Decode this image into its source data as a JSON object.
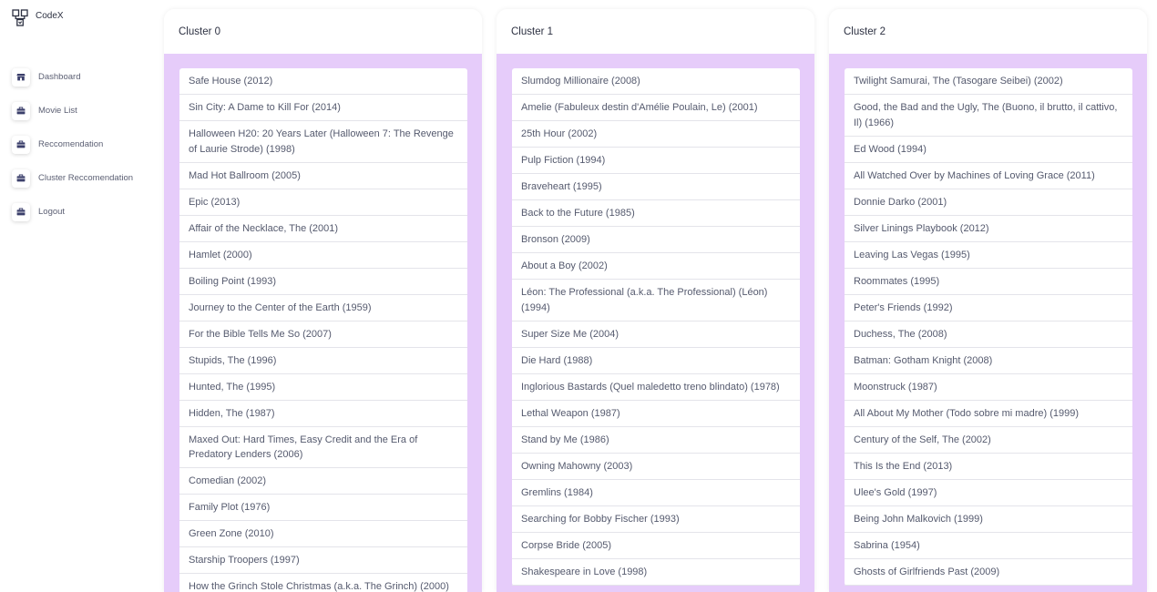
{
  "app": {
    "brand": "CodeX"
  },
  "sidebar": {
    "items": [
      {
        "label": "Dashboard",
        "icon": "store-icon"
      },
      {
        "label": "Movie List",
        "icon": "briefcase-icon"
      },
      {
        "label": "Reccomendation",
        "icon": "briefcase-icon"
      },
      {
        "label": "Cluster Reccomendation",
        "icon": "briefcase-icon"
      },
      {
        "label": "Logout",
        "icon": "briefcase-icon"
      }
    ]
  },
  "clusters": [
    {
      "title": "Cluster 0",
      "movies": [
        "Safe House (2012)",
        "Sin City: A Dame to Kill For (2014)",
        "Halloween H20: 20 Years Later (Halloween 7: The Revenge of Laurie Strode) (1998)",
        "Mad Hot Ballroom (2005)",
        "Epic (2013)",
        "Affair of the Necklace, The (2001)",
        "Hamlet (2000)",
        "Boiling Point (1993)",
        "Journey to the Center of the Earth (1959)",
        "For the Bible Tells Me So (2007)",
        "Stupids, The (1996)",
        "Hunted, The (1995)",
        "Hidden, The (1987)",
        "Maxed Out: Hard Times, Easy Credit and the Era of Predatory Lenders (2006)",
        "Comedian (2002)",
        "Family Plot (1976)",
        "Green Zone (2010)",
        "Starship Troopers (1997)",
        "How the Grinch Stole Christmas (a.k.a. The Grinch) (2000)"
      ]
    },
    {
      "title": "Cluster 1",
      "movies": [
        "Slumdog Millionaire (2008)",
        "Amelie (Fabuleux destin d'Amélie Poulain, Le) (2001)",
        "25th Hour (2002)",
        "Pulp Fiction (1994)",
        "Braveheart (1995)",
        "Back to the Future (1985)",
        "Bronson (2009)",
        "About a Boy (2002)",
        "Léon: The Professional (a.k.a. The Professional) (Léon) (1994)",
        "Super Size Me (2004)",
        "Die Hard (1988)",
        "Inglorious Bastards (Quel maledetto treno blindato) (1978)",
        "Lethal Weapon (1987)",
        "Stand by Me (1986)",
        "Owning Mahowny (2003)",
        "Gremlins (1984)",
        "Searching for Bobby Fischer (1993)",
        "Corpse Bride (2005)",
        "Shakespeare in Love (1998)"
      ]
    },
    {
      "title": "Cluster 2",
      "movies": [
        "Twilight Samurai, The (Tasogare Seibei) (2002)",
        "Good, the Bad and the Ugly, The (Buono, il brutto, il cattivo, Il) (1966)",
        "Ed Wood (1994)",
        "All Watched Over by Machines of Loving Grace (2011)",
        "Donnie Darko (2001)",
        "Silver Linings Playbook (2012)",
        "Leaving Las Vegas (1995)",
        "Roommates (1995)",
        "Peter's Friends (1992)",
        "Duchess, The (2008)",
        "Batman: Gotham Knight (2008)",
        "Moonstruck (1987)",
        "All About My Mother (Todo sobre mi madre) (1999)",
        "Century of the Self, The (2002)",
        "This Is the End (2013)",
        "Ulee's Gold (1997)",
        "Being John Malkovich (1999)",
        "Sabrina (1954)",
        "Ghosts of Girlfriends Past (2009)"
      ]
    }
  ],
  "colors": {
    "accent": "#e6ccfa",
    "icon": "#3b3f6b",
    "text": "#555a6e"
  }
}
